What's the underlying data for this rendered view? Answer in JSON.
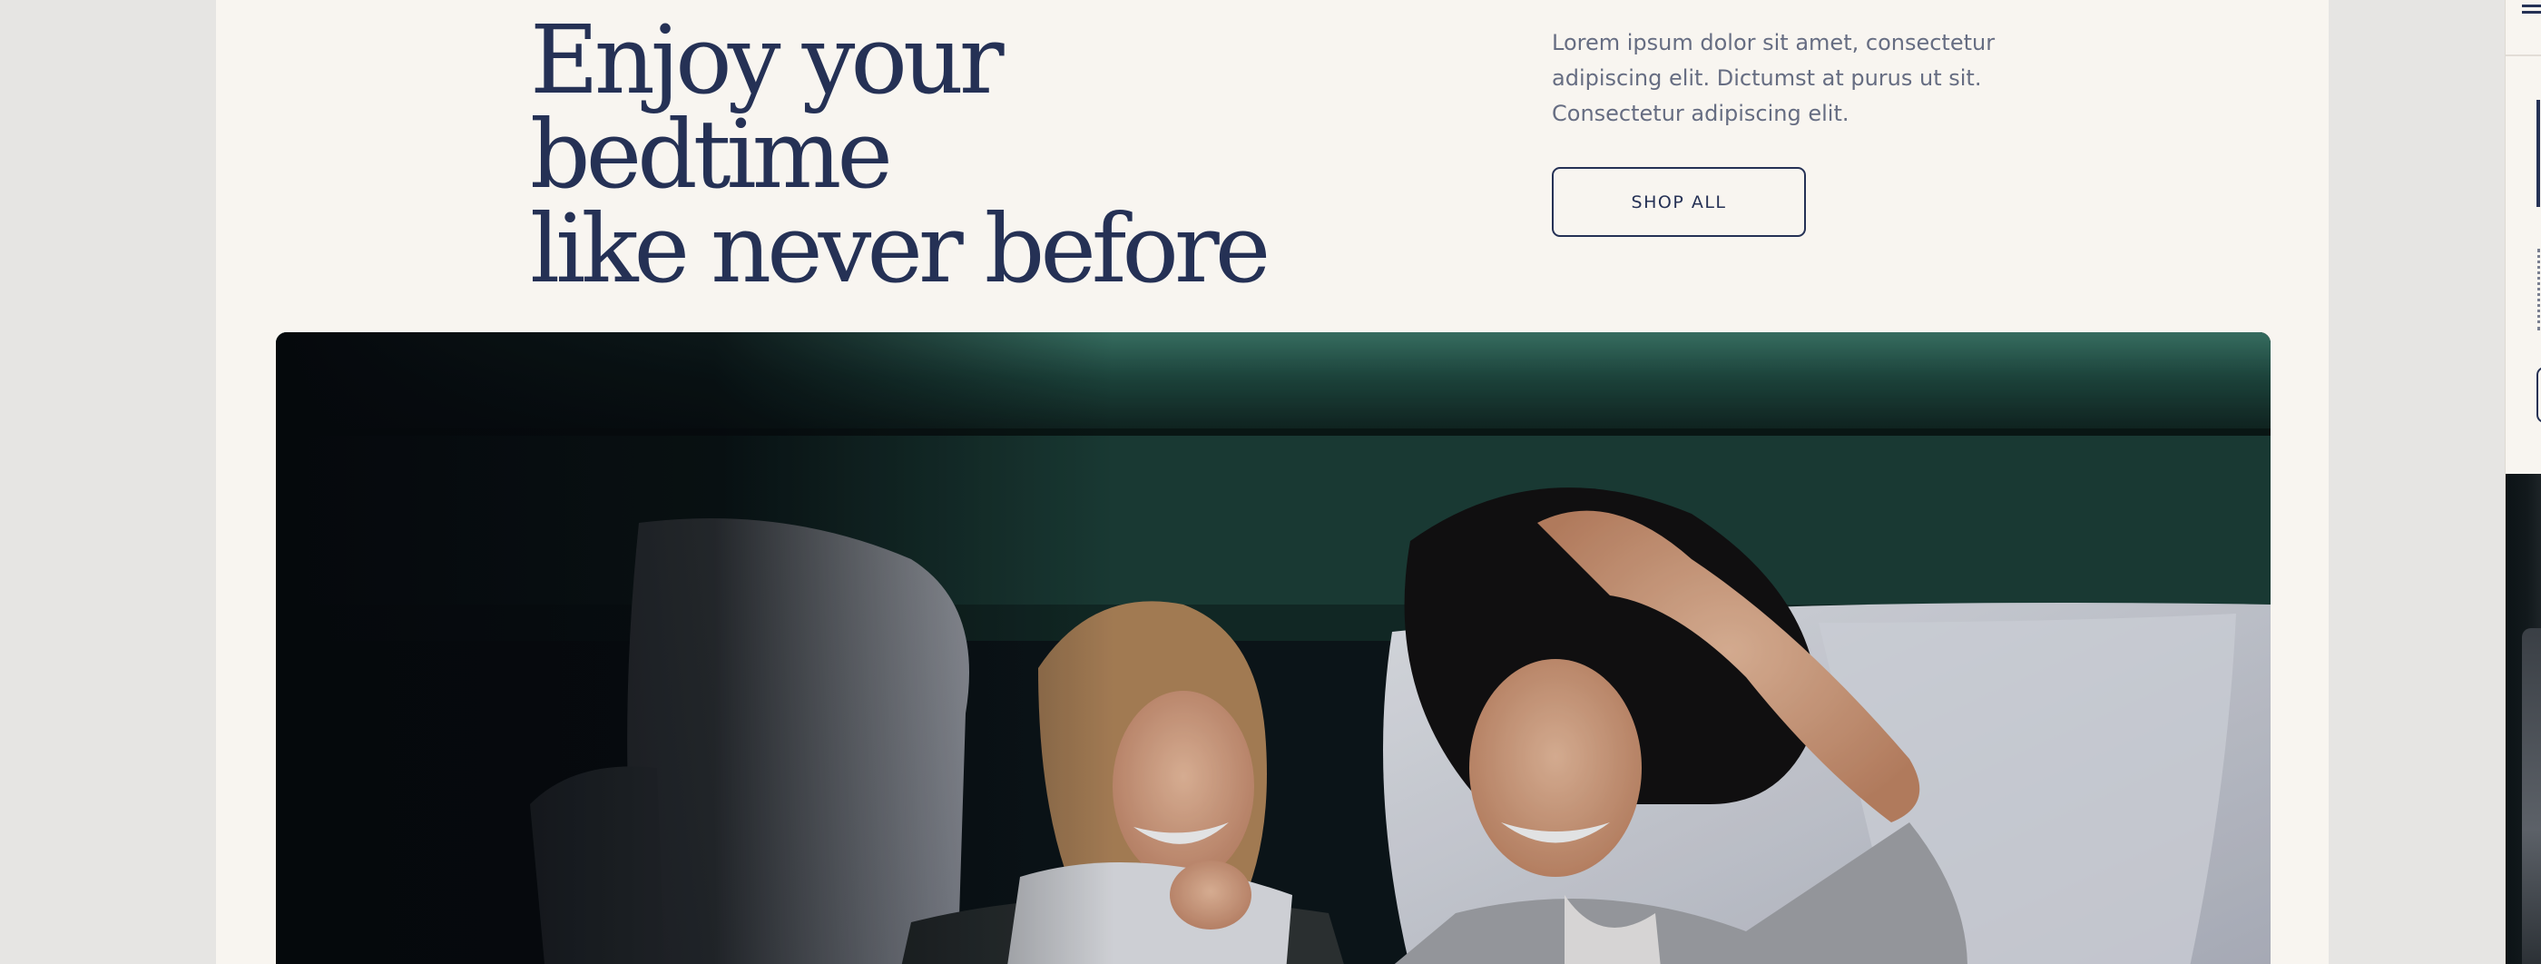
{
  "hero": {
    "title_line1": "Enjoy your bedtime",
    "title_line2": "like never before",
    "description": "Lorem ipsum dolor sit amet, consectetur adipiscing elit. Dictumst at purus ut sit. Consectetur adipiscing elit.",
    "cta_label": "SHOP ALL"
  },
  "colors": {
    "page_background": "#e6e5e3",
    "section_background": "#f8f5f0",
    "heading_navy": "#253155",
    "body_text": "#666d82",
    "headboard_green": "#1f4a40"
  },
  "icons": {
    "peek_menu": "hamburger-menu-icon"
  }
}
